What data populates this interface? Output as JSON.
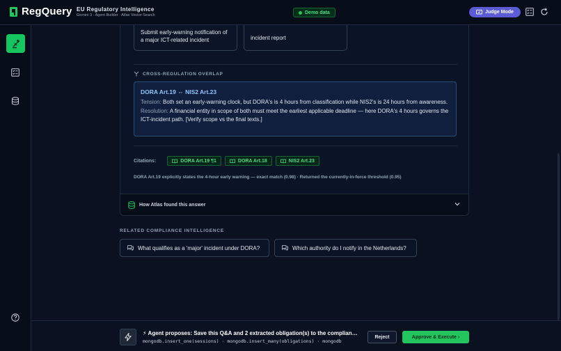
{
  "header": {
    "logo_text": "RegQuery",
    "title": "EU Regulatory Intelligence",
    "subtitle": "Gemini 3 · Agent Builder · Atlas Vector Search",
    "demo_badge": "Demo data",
    "judge_mode_label": "Judge Mode",
    "icons": [
      "reports-icon",
      "refresh-icon"
    ]
  },
  "sidebar": {
    "items": [
      {
        "name": "query",
        "icon": "scale-icon",
        "active": true
      },
      {
        "name": "reports",
        "icon": "reports-icon",
        "active": false
      },
      {
        "name": "database",
        "icon": "database-icon",
        "active": false
      }
    ],
    "help_icon": "help-icon"
  },
  "answer": {
    "steps": [
      "Submit early-warning notification of a major ICT-related incident",
      "incident report"
    ],
    "overlap": {
      "section_title": "CROSS-REGULATION OVERLAP",
      "heading": "DORA Art.19 ⇔ NIS2 Art.23",
      "tension_label": "Tension:",
      "tension_text": "Both set an early-warning clock, but DORA's is 4 hours from classification while NIS2's is 24 hours from awareness.",
      "resolution_label": "Resolution:",
      "resolution_text": "A financial entity in scope of both must meet the earliest applicable deadline — here DORA's 4 hours governs the ICT-incident path. [Verify scope vs the final texts.]"
    },
    "citations_label": "Citations:",
    "citations": [
      "DORA Art.19 ¶1",
      "DORA Art.18",
      "NIS2 Art.23"
    ],
    "verification": "DORA Art.19 explicitly states the 4-hour early warning — exact match (0.98) · Returned the currently-in-force threshold (0.95)",
    "how_found_label": "How Atlas found this answer"
  },
  "related": {
    "title": "RELATED COMPLIANCE INTELLIGENCE",
    "questions": [
      "What qualifies as a 'major' incident under DORA?",
      "Which authority do I notify in the Netherlands?"
    ]
  },
  "proposal": {
    "title": "⚡ Agent proposes: Save this Q&A and 2 extracted obligation(s) to the complian…",
    "operations": "mongodb.insert_one(sessions) · mongodb.insert_many(obligations) · mongodb",
    "reject_label": "Reject",
    "approve_label": "Approve & Execute ›"
  },
  "colors": {
    "accent_green": "#22c55e",
    "judge_purple": "#5b5bd6",
    "overlap_blue": "#93c5fd",
    "background": "#0b1120"
  }
}
